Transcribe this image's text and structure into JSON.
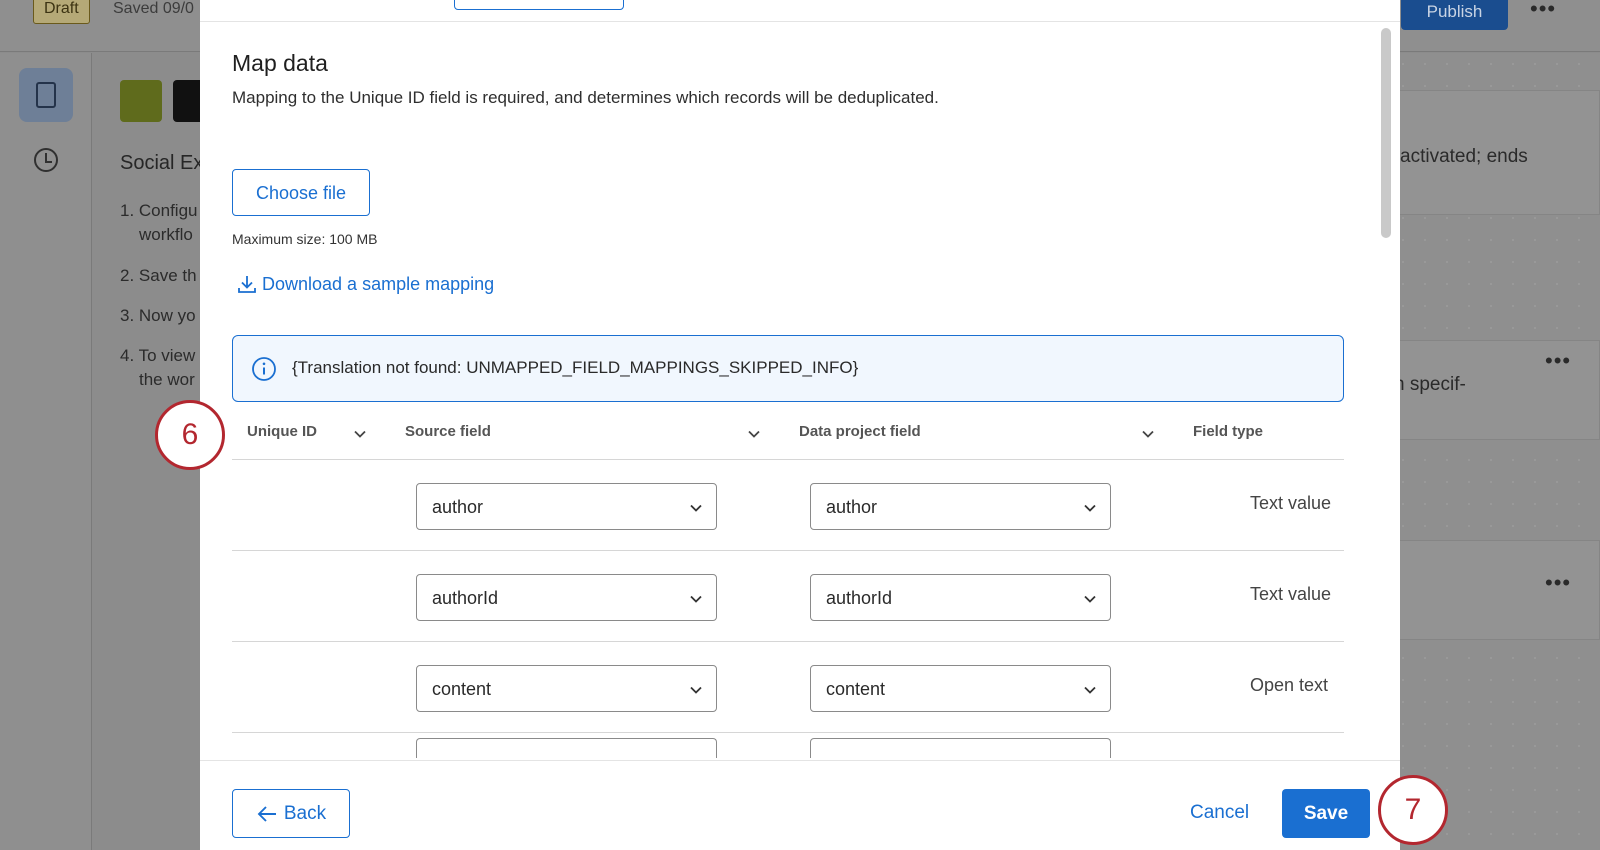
{
  "background": {
    "draft_badge": "Draft",
    "saved_text": "Saved 09/0",
    "publish_label": "Publish",
    "more_label": "•••",
    "panel_title": "Social Ex",
    "steps": [
      "1. Configu",
      "workflo",
      "2. Save th",
      "3. Now yo",
      "4. To view",
      "the wor"
    ],
    "right_texts": [
      "activated; ends",
      "n specif-"
    ]
  },
  "modal": {
    "title": "Map data",
    "description": "Mapping to the Unique ID field is required, and determines which records will be deduplicated.",
    "choose_file_label": "Choose file",
    "max_size": "Maximum size: 100 MB",
    "download_label": "Download a sample mapping",
    "info_text": "{Translation not found: UNMAPPED_FIELD_MAPPINGS_SKIPPED_INFO}",
    "table": {
      "headers": [
        "Unique ID",
        "Source field",
        "Data project field",
        "Field type"
      ],
      "rows": [
        {
          "source": "author",
          "project": "author",
          "type": "Text value"
        },
        {
          "source": "authorId",
          "project": "authorId",
          "type": "Text value"
        },
        {
          "source": "content",
          "project": "content",
          "type": "Open text"
        }
      ]
    },
    "footer": {
      "back_label": "Back",
      "cancel_label": "Cancel",
      "save_label": "Save"
    }
  },
  "callouts": [
    "6",
    "7"
  ],
  "colors": {
    "accent": "#1a6fd1",
    "callout": "#b3272f",
    "info_bg": "#f1f7fe",
    "overlay": "#8c8c8c"
  }
}
